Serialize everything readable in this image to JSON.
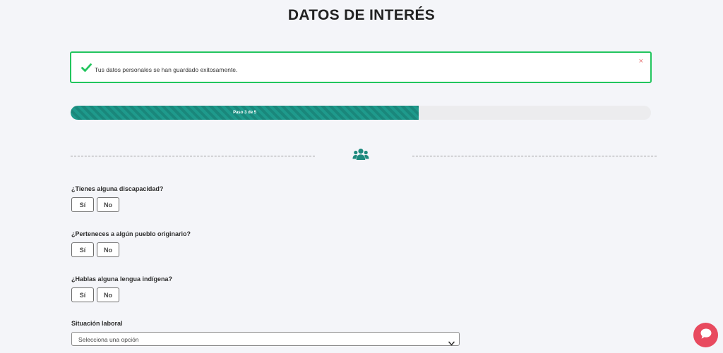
{
  "page": {
    "title": "DATOS DE INTERÉS"
  },
  "alert": {
    "message": "Tus datos personales se han guardado exitosamente.",
    "close_glyph": "×",
    "border_color": "#22c55e",
    "icon": "check-icon"
  },
  "progress": {
    "label": "Paso 3 de 5",
    "fill_fraction": 0.6,
    "color": "#1e9a8c"
  },
  "section": {
    "icon": "users-icon"
  },
  "questions": [
    {
      "label": "¿Tienes alguna discapacidad?",
      "yes_label": "Sí",
      "no_label": "No"
    },
    {
      "label": "¿Perteneces a algún pueblo originario?",
      "yes_label": "Sí",
      "no_label": "No"
    },
    {
      "label": "¿Hablas alguna lengua indígena?",
      "yes_label": "Sí",
      "no_label": "No"
    }
  ],
  "employment": {
    "label": "Situación laboral",
    "selected": "Selecciona una opción"
  },
  "chat": {
    "icon": "chat-bubble-icon",
    "color": "#e84a5f"
  }
}
